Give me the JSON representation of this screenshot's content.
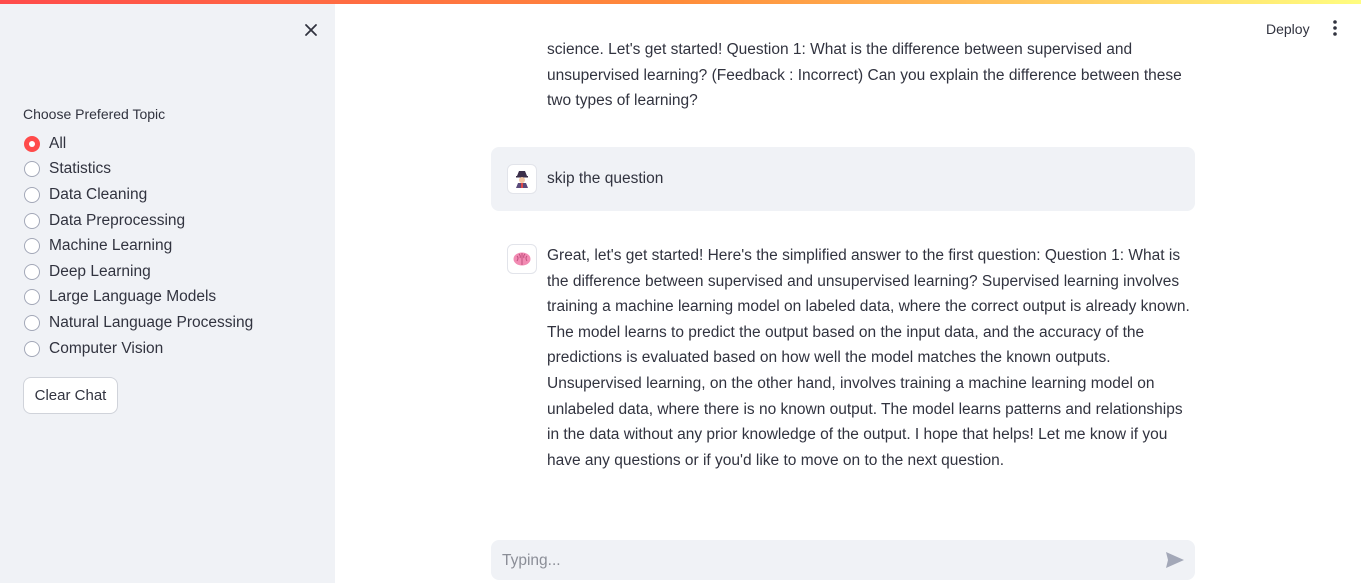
{
  "colors": {
    "accent": "#ff4b4b",
    "sidebar_bg": "#f0f2f6",
    "text": "#31333f"
  },
  "sidebar": {
    "close_icon": "close-icon",
    "topic_label": "Choose Prefered Topic",
    "topics": [
      {
        "label": "All",
        "selected": true
      },
      {
        "label": "Statistics",
        "selected": false
      },
      {
        "label": "Data Cleaning",
        "selected": false
      },
      {
        "label": "Data Preprocessing",
        "selected": false
      },
      {
        "label": "Machine Learning",
        "selected": false
      },
      {
        "label": "Deep Learning",
        "selected": false
      },
      {
        "label": "Large Language Models",
        "selected": false
      },
      {
        "label": "Natural Language Processing",
        "selected": false
      },
      {
        "label": "Computer Vision",
        "selected": false
      }
    ],
    "clear_button": "Clear Chat"
  },
  "header": {
    "deploy_label": "Deploy",
    "menu_icon": "more-vertical-icon"
  },
  "chat": {
    "messages": [
      {
        "role": "assistant",
        "text": "science. Let's get started! Question 1: What is the difference between supervised and unsupervised learning? (Feedback : Incorrect) Can you explain the difference between these two types of learning?"
      },
      {
        "role": "user",
        "avatar_icon": "user-avatar-icon",
        "text": "skip the question"
      },
      {
        "role": "assistant",
        "avatar_icon": "brain-icon",
        "text": "Great, let's get started! Here's the simplified answer to the first question: Question 1: What is the difference between supervised and unsupervised learning? Supervised learning involves training a machine learning model on labeled data, where the correct output is already known. The model learns to predict the output based on the input data, and the accuracy of the predictions is evaluated based on how well the model matches the known outputs. Unsupervised learning, on the other hand, involves training a machine learning model on unlabeled data, where there is no known output. The model learns patterns and relationships in the data without any prior knowledge of the output. I hope that helps! Let me know if you have any questions or if you'd like to move on to the next question."
      }
    ],
    "input": {
      "placeholder": "Typing...",
      "value": "",
      "send_icon": "send-icon"
    }
  }
}
